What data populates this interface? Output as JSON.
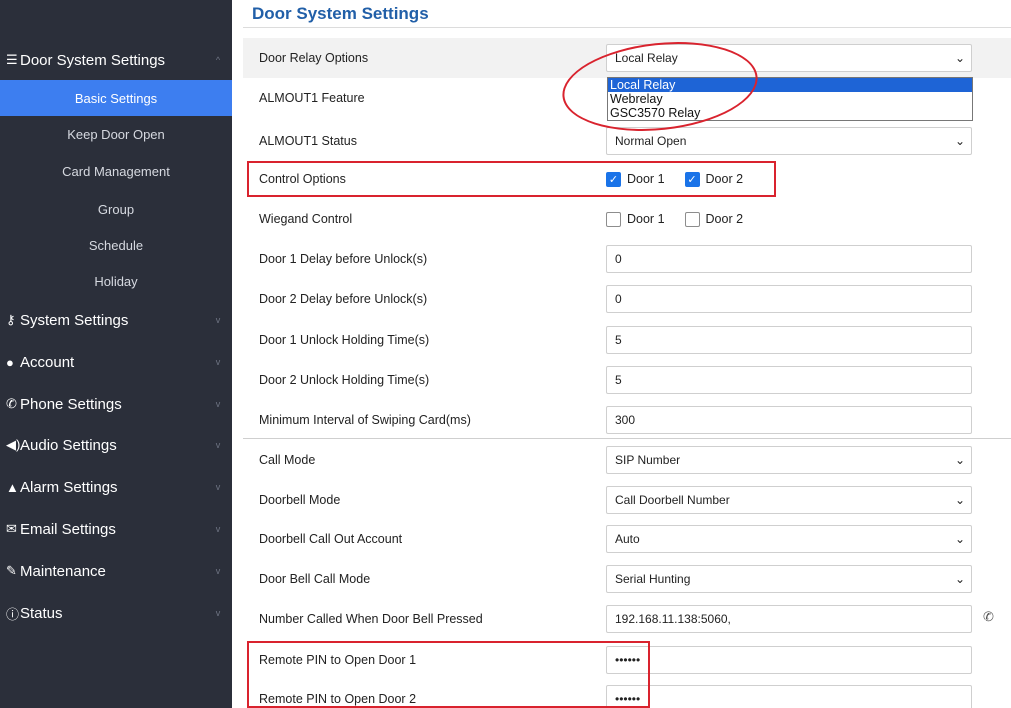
{
  "page": {
    "title": "Door System Settings"
  },
  "sidebar": {
    "items": [
      {
        "icon": "list-icon",
        "label": "Door System Settings",
        "chevron": "^"
      },
      {
        "label": "Basic Settings",
        "active": true
      },
      {
        "label": "Keep Door Open"
      },
      {
        "label": "Card Management"
      },
      {
        "label": "Group"
      },
      {
        "label": "Schedule"
      },
      {
        "label": "Holiday"
      },
      {
        "icon": "key-icon",
        "label": "System Settings",
        "chevron": "v"
      },
      {
        "icon": "user-icon",
        "label": "Account",
        "chevron": "v"
      },
      {
        "icon": "phone-icon",
        "label": "Phone Settings",
        "chevron": "v"
      },
      {
        "icon": "speaker-icon",
        "label": "Audio Settings",
        "chevron": "v"
      },
      {
        "icon": "bell-icon",
        "label": "Alarm Settings",
        "chevron": "v"
      },
      {
        "icon": "envelope-icon",
        "label": "Email Settings",
        "chevron": "v"
      },
      {
        "icon": "wrench-icon",
        "label": "Maintenance",
        "chevron": "v"
      },
      {
        "icon": "info-icon",
        "label": "Status",
        "chevron": "v"
      }
    ]
  },
  "settings": {
    "door_relay_options": {
      "label": "Door Relay Options",
      "value": "Local Relay"
    },
    "almout1_feature": {
      "label": "ALMOUT1 Feature"
    },
    "almout1_status": {
      "label": "ALMOUT1 Status",
      "value": "Normal Open"
    },
    "control_options": {
      "label": "Control Options",
      "door1": "Door 1",
      "door2": "Door 2",
      "door1_checked": true,
      "door2_checked": true
    },
    "wiegand_control": {
      "label": "Wiegand Control",
      "door1": "Door 1",
      "door2": "Door 2",
      "door1_checked": false,
      "door2_checked": false
    },
    "door1_delay": {
      "label": "Door 1 Delay before Unlock(s)",
      "value": "0"
    },
    "door2_delay": {
      "label": "Door 2 Delay before Unlock(s)",
      "value": "0"
    },
    "door1_holding": {
      "label": "Door 1 Unlock Holding Time(s)",
      "value": "5"
    },
    "door2_holding": {
      "label": "Door 2 Unlock Holding Time(s)",
      "value": "5"
    },
    "min_interval": {
      "label": "Minimum Interval of Swiping Card(ms)",
      "value": "300"
    },
    "call_mode": {
      "label": "Call Mode",
      "value": "SIP Number"
    },
    "doorbell_mode": {
      "label": "Doorbell Mode",
      "value": "Call Doorbell Number"
    },
    "doorbell_account": {
      "label": "Doorbell Call Out Account",
      "value": "Auto"
    },
    "doorbell_call_mode": {
      "label": "Door Bell Call Mode",
      "value": "Serial Hunting"
    },
    "number_called": {
      "label": "Number Called When Door Bell Pressed",
      "value": "192.168.11.138:5060,"
    },
    "remote_pin1": {
      "label": "Remote PIN to Open Door 1",
      "value": "••••••"
    },
    "remote_pin2": {
      "label": "Remote PIN to Open Door 2",
      "value": "••••••"
    }
  },
  "dropdown": {
    "options": [
      "Local Relay",
      "Webrelay",
      "GSC3570 Relay"
    ],
    "selected": "Local Relay"
  },
  "colors": {
    "sidebar_bg": "#2b2f3a",
    "active_item": "#3d7ef0",
    "title": "#215fa8",
    "annotation": "#d9232e",
    "checkbox": "#1a73e8"
  }
}
